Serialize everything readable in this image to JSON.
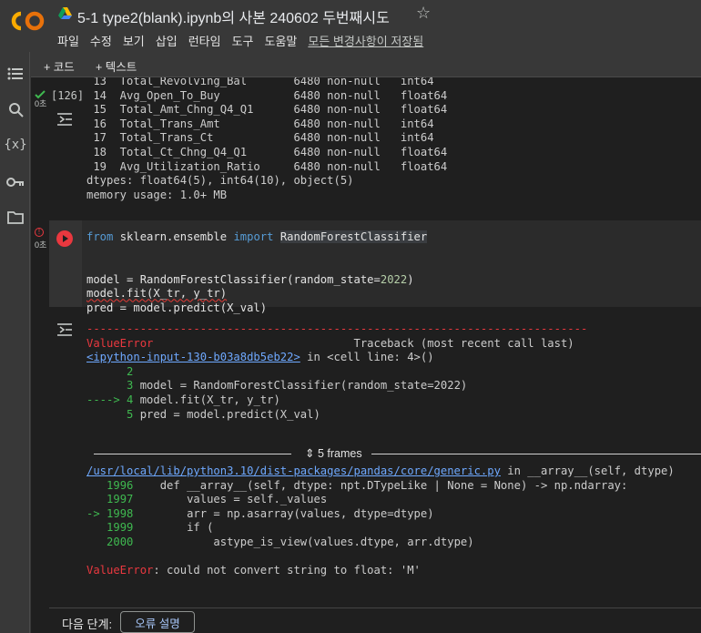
{
  "app": {
    "title": "5-1 type2(blank).ipynb의 사본 240602 두번째시도",
    "menu": [
      "파일",
      "수정",
      "보기",
      "삽입",
      "런타임",
      "도구",
      "도움말"
    ],
    "saved_status": "모든 변경사항이 저장됨",
    "colors": {
      "logo_orange": "#f9ab00",
      "logo_yellow": "#e8710a",
      "error_red": "#e9383f",
      "link_blue": "#6ea8fe"
    }
  },
  "toolbar": {
    "add_code": "+ 코드",
    "add_text": "+ 텍스트"
  },
  "rail_icons": [
    "toc-icon",
    "search-icon",
    "variables-icon",
    "key-icon",
    "folder-icon"
  ],
  "cell1": {
    "exec_count": "[126]",
    "exec_time": "0초",
    "output_lines": [
      " 13  Total_Revolving_Bal       6480 non-null   int64",
      " 14  Avg_Open_To_Buy           6480 non-null   float64",
      " 15  Total_Amt_Chng_Q4_Q1      6480 non-null   float64",
      " 16  Total_Trans_Amt           6480 non-null   int64",
      " 17  Total_Trans_Ct            6480 non-null   int64",
      " 18  Total_Ct_Chng_Q4_Q1       6480 non-null   float64",
      " 19  Avg_Utilization_Ratio     6480 non-null   float64",
      "dtypes: float64(5), int64(10), object(5)",
      "memory usage: 1.0+ MB"
    ]
  },
  "cell2": {
    "exec_time": "0초",
    "code": {
      "l1_from": "from",
      "l1_mod": " sklearn.ensemble ",
      "l1_import": "import",
      "l1_cls": "RandomForestClassifier",
      "l3a": "model = RandomForestClassifier(random_state=",
      "l3num": "2022",
      "l3b": ")",
      "l4": "model.fit(X_tr, y_tr)",
      "l5": "pred = model.predict(X_val)"
    },
    "traceback": {
      "dashes": "---------------------------------------------------------------------------",
      "err_name": "ValueError",
      "tb_label": "                              Traceback (most recent call last)",
      "link1": "<ipython-input-130-b03a8db5eb22>",
      "link1_suffix": " in <cell line: 4>()",
      "ctx": [
        {
          "arrow": "      ",
          "no": "2",
          "code": ""
        },
        {
          "arrow": "      ",
          "no": "3",
          "code": " model = RandomForestClassifier(random_state=2022)"
        },
        {
          "arrow": "----> ",
          "no": "4",
          "code": " model.fit(X_tr, y_tr)"
        },
        {
          "arrow": "      ",
          "no": "5",
          "code": " pred = model.predict(X_val)"
        }
      ],
      "frames_label": "5 frames",
      "link2": "/usr/local/lib/python3.10/dist-packages/pandas/core/generic.py",
      "link2_suffix": " in __array__(self, dtype)",
      "src": [
        {
          "arrow": "   ",
          "no": "1996",
          "code": "    def __array__(self, dtype: npt.DTypeLike | None = None) -> np.ndarray:"
        },
        {
          "arrow": "   ",
          "no": "1997",
          "code": "        values = self._values"
        },
        {
          "arrow": "-> ",
          "no": "1998",
          "code": "        arr = np.asarray(values, dtype=dtype)"
        },
        {
          "arrow": "   ",
          "no": "1999",
          "code": "        if ("
        },
        {
          "arrow": "   ",
          "no": "2000",
          "code": "            astype_is_view(values.dtype, arr.dtype)"
        }
      ],
      "final_name": "ValueError",
      "final_msg": ": could not convert string to float: 'M'"
    }
  },
  "next_step": {
    "label": "다음 단계:",
    "button": "오류 설명"
  }
}
